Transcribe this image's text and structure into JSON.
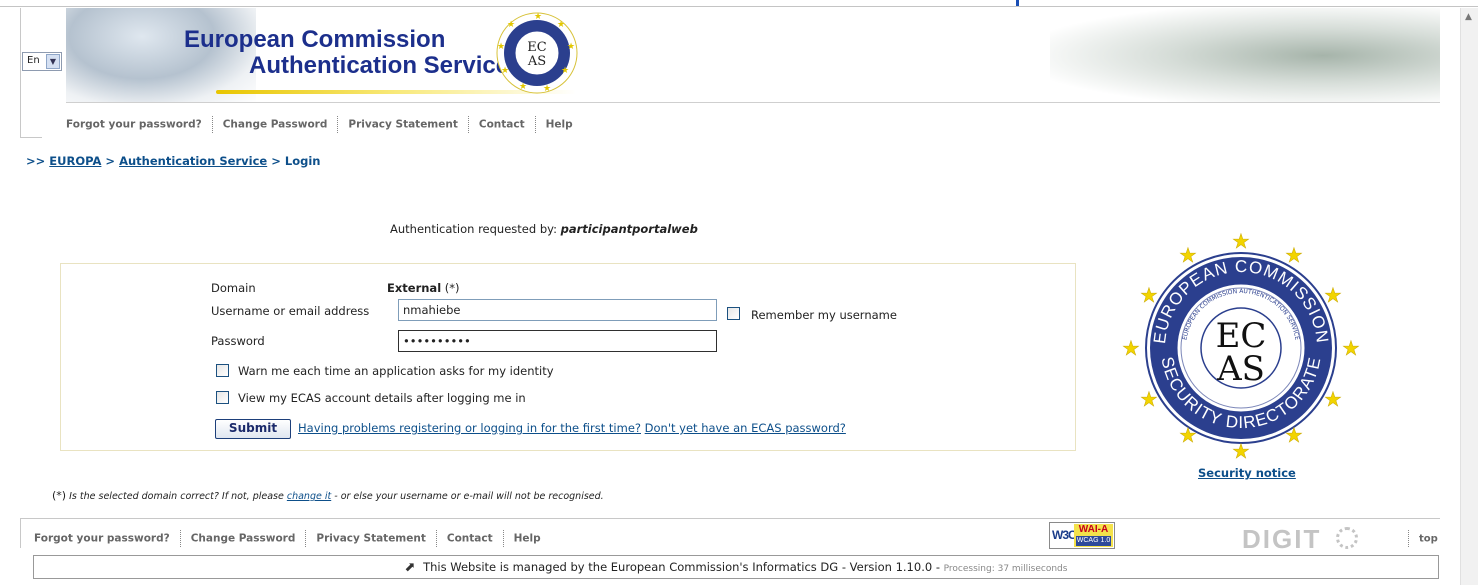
{
  "language": {
    "selected": "En"
  },
  "banner": {
    "title_line1": "European Commission",
    "title_line2": "Authentication Service",
    "seal_small_text_top": "EC",
    "seal_small_text_bottom": "AS"
  },
  "nav": {
    "items": [
      "Forgot your password?",
      "Change Password",
      "Privacy Statement",
      "Contact",
      "Help"
    ]
  },
  "breadcrumb": {
    "prefix": ">>",
    "items": [
      "EUROPA",
      "Authentication Service",
      "Login"
    ],
    "sep": ">"
  },
  "auth_request": {
    "label": "Authentication requested by:",
    "value": "participantportalweb"
  },
  "login": {
    "domain_label": "Domain",
    "domain_value": "External",
    "domain_suffix": "(*)",
    "username_label": "Username or email address",
    "username_value": "nmahiebe",
    "remember_label": "Remember my username",
    "password_label": "Password",
    "password_value": "••••••••••",
    "warn_label": "Warn me each time an application asks for my identity",
    "view_label": "View my ECAS account details after logging me in",
    "submit_label": "Submit",
    "help_link1": "Having problems registering or logging in for the first time?",
    "help_link2": "Don't yet have an ECAS password?"
  },
  "seal": {
    "outer_text_top": "EUROPEAN COMMISSION",
    "outer_text_bottom": "SECURITY DIRECTORATE",
    "inner_text": "EUROPEAN COMMISSION AUTHENTICATION SERVICE",
    "center_line1": "EC",
    "center_line2": "AS"
  },
  "security_notice": "Security notice",
  "footnote": {
    "asterisk": "(*)",
    "text1": "Is the selected domain correct? If not, please",
    "link": "change it",
    "text2": "- or else your username or e-mail will not be recognised."
  },
  "footer": {
    "w3c": "W3C",
    "wai": "WAI-A",
    "wcag": "WCAG 1.0",
    "digit": "DIGIT",
    "top": "top",
    "managed": "This Website is managed by the European Commission's Informatics DG - Version 1.10.0 -",
    "processing": "Processing: 37 milliseconds"
  },
  "colors": {
    "accent": "#0d4f8a",
    "banner_title": "#1c2f8c",
    "box_border": "#e9e3c1"
  },
  "icons": [
    "chevron-down-icon",
    "scroll-up-icon",
    "mouse-icon",
    "star-icon"
  ]
}
